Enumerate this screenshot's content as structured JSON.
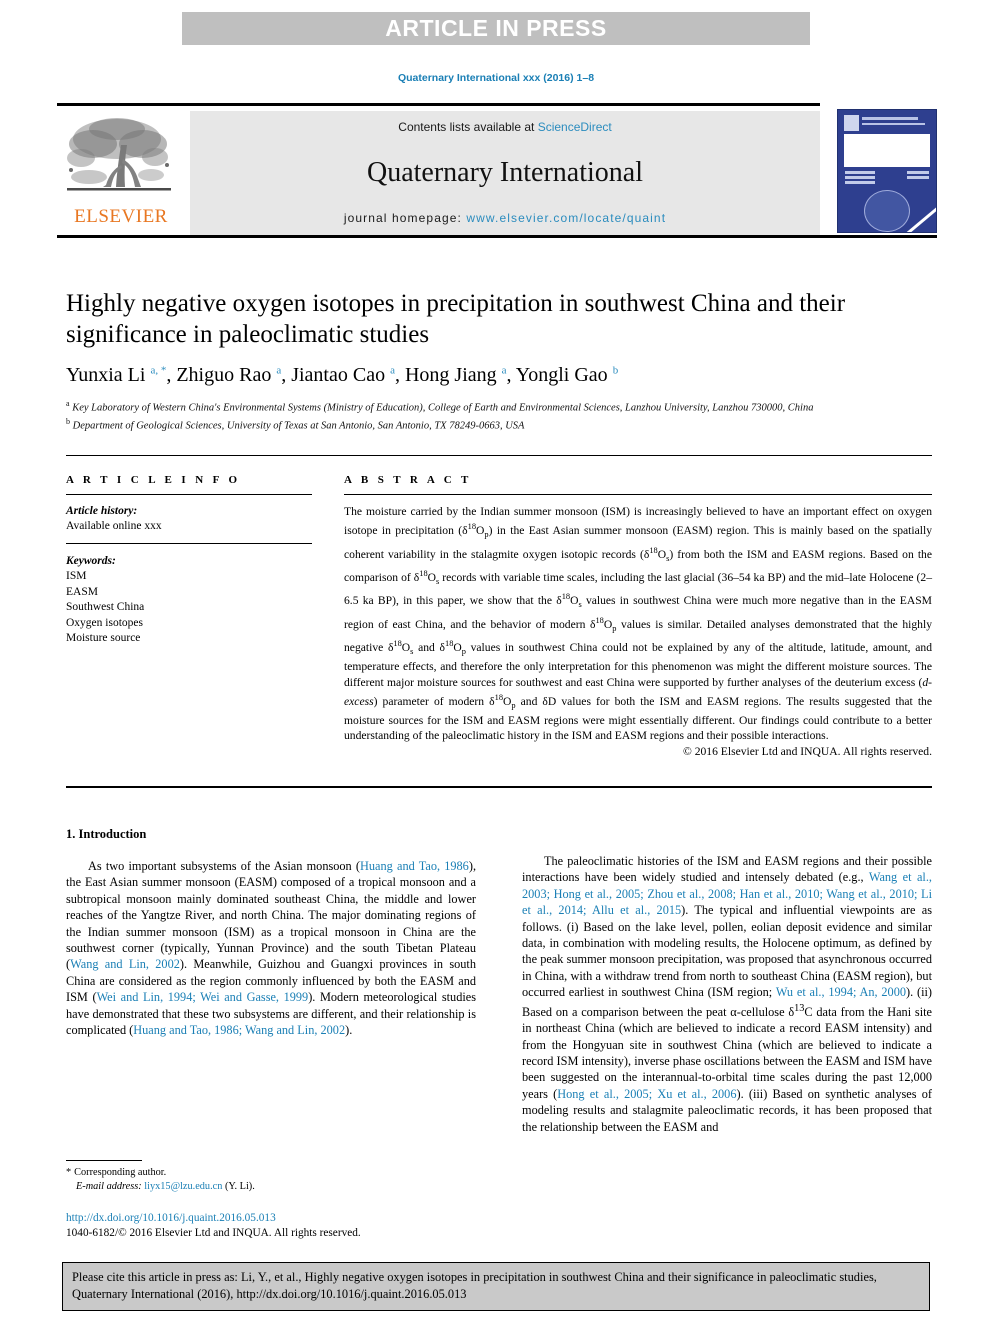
{
  "banner": {
    "text": "ARTICLE IN PRESS"
  },
  "journal_ref": "Quaternary International xxx (2016) 1–8",
  "masthead": {
    "contents_prefix": "Contents lists available at ",
    "sciencedirect": "ScienceDirect",
    "journal_title": "Quaternary International",
    "homepage_prefix": "journal homepage: ",
    "homepage_url": "www.elsevier.com/locate/quaint",
    "publisher_name": "ELSEVIER",
    "publisher_logo_icon": "elsevier-tree-icon",
    "cover_thumb_icon": "journal-cover-thumbnail"
  },
  "article": {
    "title": "Highly negative oxygen isotopes in precipitation in southwest China and their significance in paleoclimatic studies",
    "authors_html": "Yunxia Li <sup>a, *</sup>, Zhiguo Rao <sup>a</sup>, Jiantao Cao <sup>a</sup>, Hong Jiang <sup>a</sup>, Yongli Gao <sup>b</sup>",
    "affiliation_a": "Key Laboratory of Western China's Environmental Systems (Ministry of Education), College of Earth and Environmental Sciences, Lanzhou University, Lanzhou 730000, China",
    "affiliation_b": "Department of Geological Sciences, University of Texas at San Antonio, San Antonio, TX 78249-0663, USA"
  },
  "info": {
    "heading": "A R T I C L E  I N F O",
    "history_label": "Article history:",
    "history_value": "Available online xxx",
    "keywords_label": "Keywords:",
    "keywords": [
      "ISM",
      "EASM",
      "Southwest China",
      "Oxygen isotopes",
      "Moisture source"
    ]
  },
  "abstract": {
    "heading": "A B S T R A C T",
    "body_html": "The moisture carried by the Indian summer monsoon (ISM) is increasingly believed to have an important effect on oxygen isotope in precipitation (δ<sup>18</sup>O<sub>p</sub>) in the East Asian summer monsoon (EASM) region. This is mainly based on the spatially coherent variability in the stalagmite oxygen isotopic records (δ<sup>18</sup>O<sub>s</sub>) from both the ISM and EASM regions. Based on the comparison of δ<sup>18</sup>O<sub>s</sub> records with variable time scales, including the last glacial (36–54 ka BP) and the mid–late Holocene (2–6.5 ka BP), in this paper, we show that the δ<sup>18</sup>O<sub>s</sub> values in southwest China were much more negative than in the EASM region of east China, and the behavior of modern δ<sup>18</sup>O<sub>p</sub> values is similar. Detailed analyses demonstrated that the highly negative δ<sup>18</sup>O<sub>s</sub> and δ<sup>18</sup>O<sub>p</sub> values in southwest China could not be explained by any of the altitude, latitude, amount, and temperature effects, and therefore the only interpretation for this phenomenon was might the different moisture sources. The different major moisture sources for southwest and east China were supported by further analyses of the deuterium excess (<i>d-excess</i>) parameter of modern δ<sup>18</sup>O<sub>p</sub> and δD values for both the ISM and EASM regions. The results suggested that the moisture sources for the ISM and EASM regions were might essentially different. Our findings could contribute to a better understanding of the paleoclimatic history in the ISM and EASM regions and their possible interactions.",
    "copyright": "© 2016 Elsevier Ltd and INQUA. All rights reserved."
  },
  "body": {
    "section_heading": "1. Introduction",
    "left_paragraph_html": "As two important subsystems of the Asian monsoon (<span class=\"cite\">Huang and Tao, 1986</span>), the East Asian summer monsoon (EASM) composed of a tropical monsoon and a subtropical monsoon mainly dominated southeast China, the middle and lower reaches of the Yangtze River, and north China. The major dominating regions of the Indian summer monsoon (ISM) as a tropical monsoon in China are the southwest corner (typically, Yunnan Province) and the south Tibetan Plateau (<span class=\"cite\">Wang and Lin, 2002</span>). Meanwhile, Guizhou and Guangxi provinces in south China are considered as the region commonly influenced by both the EASM and ISM (<span class=\"cite\">Wei and Lin, 1994; Wei and Gasse, 1999</span>). Modern meteorological studies have demonstrated that these two subsystems are different, and their relationship is complicated (<span class=\"cite\">Huang and Tao, 1986; Wang and Lin, 2002</span>).",
    "right_paragraph_html": "The paleoclimatic histories of the ISM and EASM regions and their possible interactions have been widely studied and intensely debated (e.g., <span class=\"cite\">Wang et al., 2003; Hong et al., 2005; Zhou et al., 2008; Han et al., 2010; Wang et al., 2010; Li et al., 2014; Allu et al., 2015</span>). The typical and influential viewpoints are as follows. (i) Based on the lake level, pollen, eolian deposit evidence and similar data, in combination with modeling results, the Holocene optimum, as defined by the peak summer monsoon precipitation, was proposed that asynchronous occurred in China, with a withdraw trend from north to southeast China (EASM region), but occurred earliest in southwest China (ISM region; <span class=\"cite\">Wu et al., 1994; An, 2000</span>). (ii) Based on a comparison between the peat α-cellulose δ<sup>13</sup>C data from the Hani site in northeast China (which are believed to indicate a record EASM intensity) and from the Hongyuan site in southwest China (which are believed to indicate a record ISM intensity), inverse phase oscillations between the EASM and ISM have been suggested on the interannual-to-orbital time scales during the past 12,000 years (<span class=\"cite\">Hong et al., 2005; Xu et al., 2006</span>). (iii) Based on synthetic analyses of modeling results and stalagmite paleoclimatic records, it has been proposed that the relationship between the EASM and"
  },
  "footer": {
    "corresponding_author": "Corresponding author.",
    "email_label": "E-mail address:",
    "email": "liyx15@lzu.edu.cn",
    "email_owner": "(Y. Li).",
    "doi": "http://dx.doi.org/10.1016/j.quaint.2016.05.013",
    "issn_line": "1040-6182/© 2016 Elsevier Ltd and INQUA. All rights reserved."
  },
  "cite_box": {
    "text": "Please cite this article in press as: Li, Y., et al., Highly negative oxygen isotopes in precipitation in southwest China and their significance in paleoclimatic studies, Quaternary International (2016), http://dx.doi.org/10.1016/j.quaint.2016.05.013"
  },
  "colors": {
    "link": "#1a7fb5",
    "banner_bg": "#bfbfbf",
    "masthead_bg": "#e7e7e7",
    "elsevier_orange": "#e87722",
    "cite_box_bg": "#c9c9c9"
  }
}
